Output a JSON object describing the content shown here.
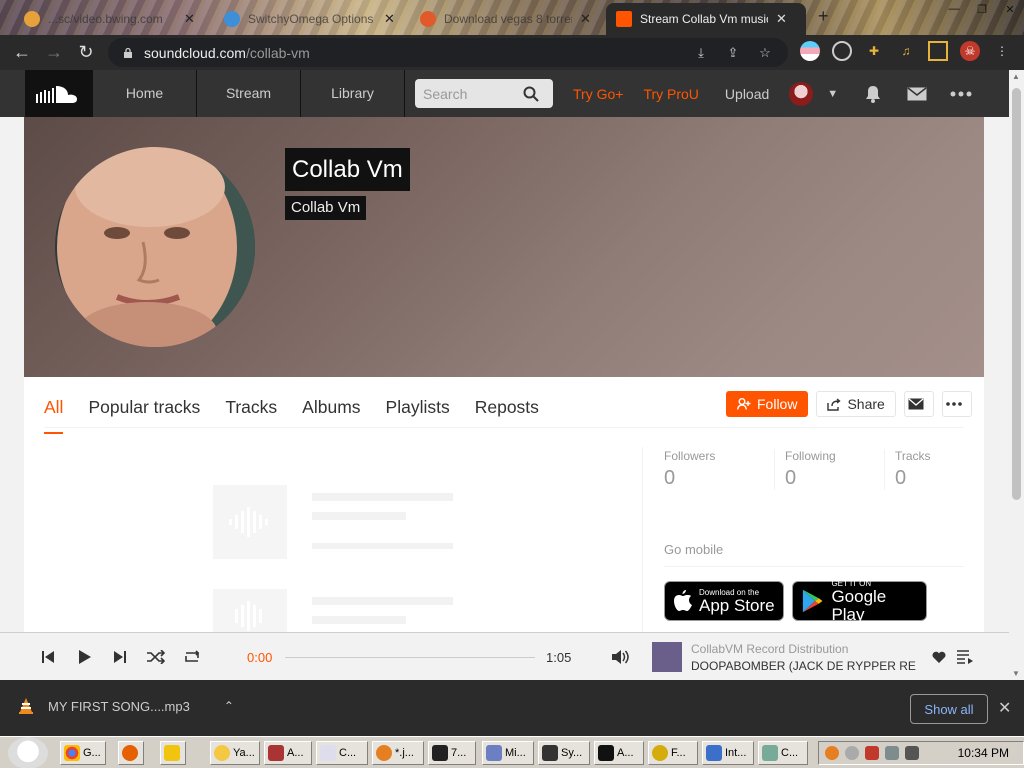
{
  "browser": {
    "tabs": [
      {
        "title": "...sc/video.bwing.com",
        "active": false
      },
      {
        "title": "SwitchyOmega Options",
        "active": false
      },
      {
        "title": "Download vegas 8 torrent",
        "active": false
      },
      {
        "title": "Stream Collab Vm music",
        "active": true
      }
    ],
    "new_tab": "+",
    "url_host": "soundcloud.com",
    "url_path": "/collab-vm"
  },
  "header": {
    "nav": [
      "Home",
      "Stream",
      "Library"
    ],
    "search_placeholder": "Search",
    "try_go": "Try Go+",
    "try_pro": "Try ProU",
    "upload": "Upload"
  },
  "profile": {
    "name": "Collab Vm",
    "subtitle": "Collab Vm"
  },
  "tabs": [
    "All",
    "Popular tracks",
    "Tracks",
    "Albums",
    "Playlists",
    "Reposts"
  ],
  "actions": {
    "follow": "Follow",
    "share": "Share"
  },
  "stats": [
    {
      "label": "Followers",
      "value": "0"
    },
    {
      "label": "Following",
      "value": "0"
    },
    {
      "label": "Tracks",
      "value": "0"
    }
  ],
  "mobile": {
    "heading": "Go mobile",
    "app_store_small": "Download on the",
    "app_store_big": "App Store",
    "play_small": "GET IT ON",
    "play_big": "Google Play"
  },
  "player": {
    "elapsed": "0:00",
    "duration": "1:05",
    "artist": "CollabVM Record Distribution",
    "title": "DOOPABOMBER (JACK DE RYPPER RE..."
  },
  "download": {
    "filename": "MY FIRST SONG....mp3",
    "show_all": "Show all"
  },
  "taskbar": {
    "items": [
      "G...",
      "",
      "",
      "Ya...",
      "A...",
      "C...",
      "*.j...",
      "7...",
      "Mi...",
      "Sy...",
      "A...",
      "F...",
      "Int...",
      "C..."
    ],
    "clock": "10:34 PM"
  },
  "colors": {
    "accent": "#ff5500",
    "header_bg": "#333333"
  }
}
